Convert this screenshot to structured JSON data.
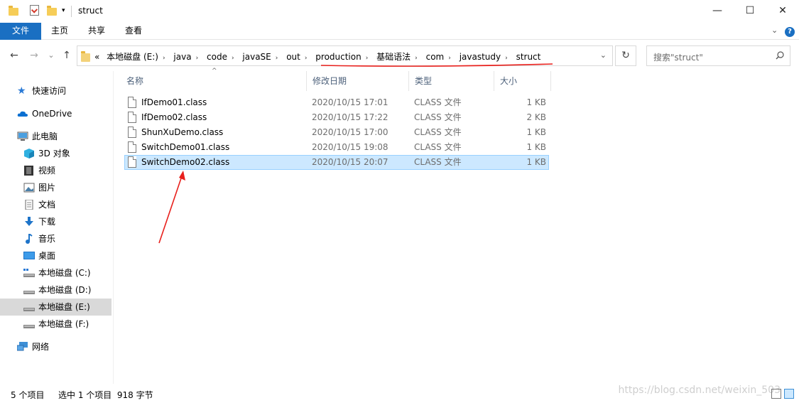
{
  "window": {
    "title": "struct",
    "minimize": "—",
    "maximize": "☐",
    "close": "✕"
  },
  "ribbon": {
    "tabs": [
      "文件",
      "主页",
      "共享",
      "查看"
    ],
    "collapse_icon": "chevron-down-icon",
    "help": "?"
  },
  "nav": {
    "back": "←",
    "forward": "→",
    "recent": "⌄",
    "up": "↑"
  },
  "address": {
    "overflow": "«",
    "crumbs": [
      "本地磁盘 (E:)",
      "java",
      "code",
      "javaSE",
      "out",
      "production",
      "基础语法",
      "com",
      "javastudy",
      "struct"
    ],
    "separator": "›",
    "dropdown": "⌄",
    "refresh": "↻"
  },
  "search": {
    "placeholder": "搜索\"struct\""
  },
  "sidebar": {
    "items": [
      {
        "label": "快速访问",
        "icon": "star-icon"
      },
      {
        "label": "OneDrive",
        "icon": "cloud-icon"
      },
      {
        "label": "此电脑",
        "icon": "computer-icon"
      },
      {
        "label": "3D 对象",
        "icon": "cube-icon"
      },
      {
        "label": "视频",
        "icon": "video-icon"
      },
      {
        "label": "图片",
        "icon": "picture-icon"
      },
      {
        "label": "文档",
        "icon": "document-icon"
      },
      {
        "label": "下载",
        "icon": "download-icon"
      },
      {
        "label": "音乐",
        "icon": "music-icon"
      },
      {
        "label": "桌面",
        "icon": "desktop-icon"
      },
      {
        "label": "本地磁盘 (C:)",
        "icon": "drive-icon"
      },
      {
        "label": "本地磁盘 (D:)",
        "icon": "drive-icon"
      },
      {
        "label": "本地磁盘 (E:)",
        "icon": "drive-icon"
      },
      {
        "label": "本地磁盘 (F:)",
        "icon": "drive-icon"
      },
      {
        "label": "网络",
        "icon": "network-icon"
      }
    ]
  },
  "filelist": {
    "columns": {
      "name": "名称",
      "modified": "修改日期",
      "type": "类型",
      "size": "大小"
    },
    "sort_indicator": "^",
    "rows": [
      {
        "name": "IfDemo01.class",
        "modified": "2020/10/15 17:01",
        "type": "CLASS 文件",
        "size": "1 KB"
      },
      {
        "name": "IfDemo02.class",
        "modified": "2020/10/15 17:22",
        "type": "CLASS 文件",
        "size": "2 KB"
      },
      {
        "name": "ShunXuDemo.class",
        "modified": "2020/10/15 17:00",
        "type": "CLASS 文件",
        "size": "1 KB"
      },
      {
        "name": "SwitchDemo01.class",
        "modified": "2020/10/15 19:08",
        "type": "CLASS 文件",
        "size": "1 KB"
      },
      {
        "name": "SwitchDemo02.class",
        "modified": "2020/10/15 20:07",
        "type": "CLASS 文件",
        "size": "1 KB"
      }
    ]
  },
  "status": {
    "count": "5 个项目",
    "selection": "选中 1 个项目  918 字节"
  },
  "watermark": "https://blog.csdn.net/weixin_503",
  "colors": {
    "accent": "#1a6fc2",
    "selection": "#cce8ff",
    "annotation": "#e8201c"
  }
}
